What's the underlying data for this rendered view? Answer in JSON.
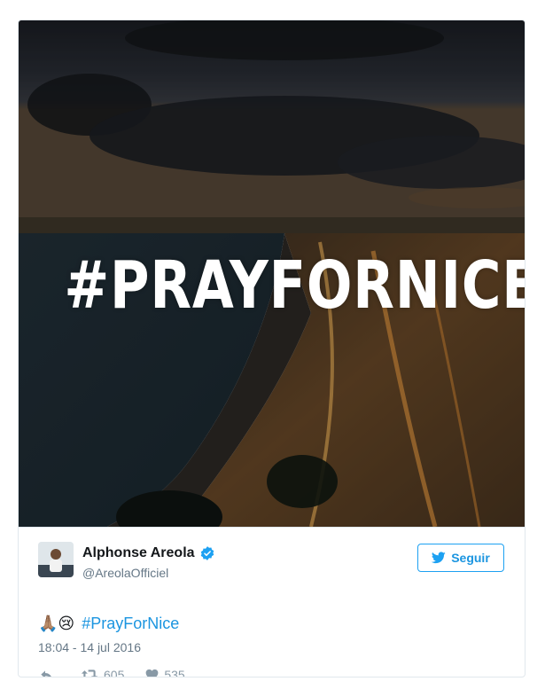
{
  "media": {
    "overlay_text": "#PRAYFORNICE"
  },
  "author": {
    "display_name": "Alphonse Areola",
    "handle": "@AreolaOfficiel",
    "verified": true
  },
  "follow_button": {
    "label": "Seguir"
  },
  "tweet": {
    "emojis": "🙏🏽😢",
    "hashtag": "#PrayForNice",
    "timestamp": "18:04 - 14 jul 2016"
  },
  "actions": {
    "retweets": "605",
    "likes": "535"
  },
  "colors": {
    "link_blue": "#1b95e0",
    "verified_blue": "#1da1f2",
    "muted_gray": "#657786"
  }
}
